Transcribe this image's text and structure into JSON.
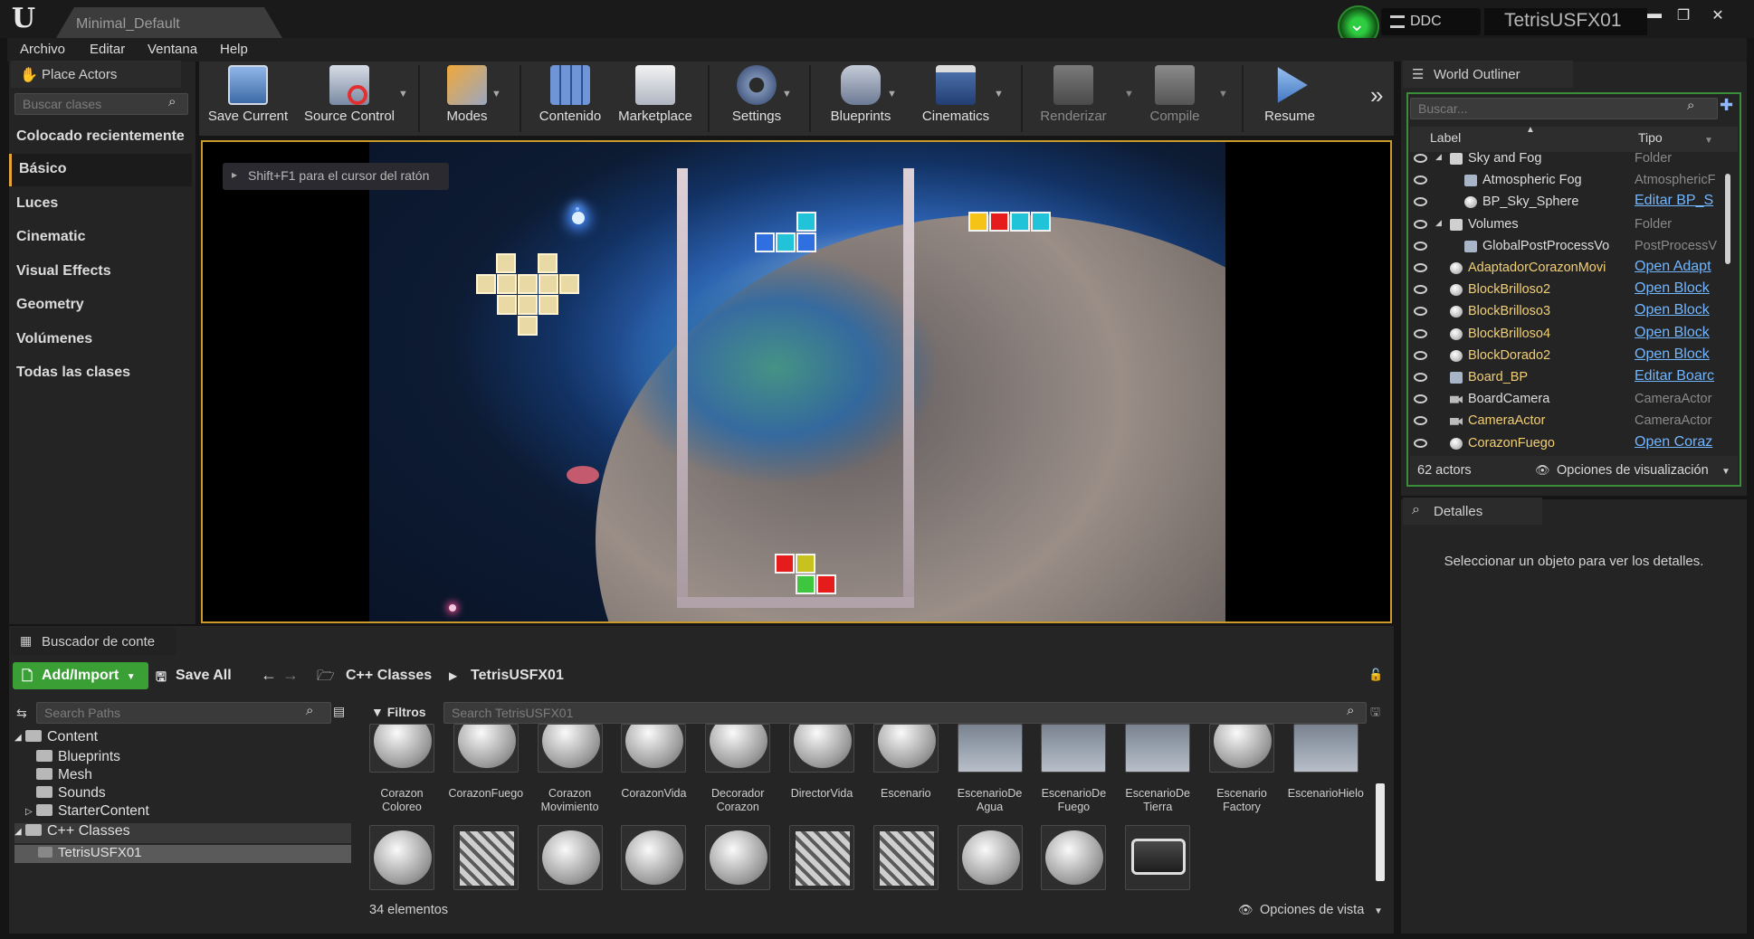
{
  "title_bar": {
    "map_tab": "Minimal_Default",
    "ddc_label": "DDC",
    "project_name": "TetrisUSFX01",
    "minimize_glyph": "▬",
    "restore_glyph": "❐",
    "close_glyph": "✕"
  },
  "menu": [
    "Archivo",
    "Editar",
    "Ventana",
    "Help"
  ],
  "place_actors": {
    "tab_label": "Place Actors",
    "search_placeholder": "Buscar clases",
    "categories": [
      "Colocado recientemente",
      "Básico",
      "Luces",
      "Cinematic",
      "Visual Effects",
      "Geometry",
      "Volúmenes",
      "Todas las clases"
    ],
    "selected": "Básico"
  },
  "toolbar": {
    "buttons": [
      {
        "label": "Save Current",
        "icon": "floppy-disk-icon"
      },
      {
        "label": "Source Control",
        "icon": "source-control-icon"
      },
      {
        "label": "Modes",
        "icon": "modes-icon"
      },
      {
        "label": "Contenido",
        "icon": "content-grid-icon"
      },
      {
        "label": "Marketplace",
        "icon": "marketplace-bag-icon"
      },
      {
        "label": "Settings",
        "icon": "gear-icon"
      },
      {
        "label": "Blueprints",
        "icon": "gamepad-icon"
      },
      {
        "label": "Cinematics",
        "icon": "clapperboard-icon"
      },
      {
        "label": "Renderizar",
        "icon": "build-icon"
      },
      {
        "label": "Compile",
        "icon": "compile-cubes-icon"
      },
      {
        "label": "Resume",
        "icon": "play-resume-icon"
      }
    ],
    "overflow_glyph": "»"
  },
  "viewport": {
    "hint": "Shift+F1 para el cursor del ratón",
    "colors": {
      "blue": "#2f6fe0",
      "cyan": "#21c3d8",
      "yellow": "#f4c316",
      "red": "#e61b1b",
      "green": "#3ec63e",
      "olive": "#c8c21e"
    }
  },
  "world_outliner": {
    "tab_label": "World Outliner",
    "search_placeholder": "Buscar...",
    "col_label": "Label",
    "col_type": "Tipo",
    "rows": [
      {
        "label": "Sky and Fog",
        "type": "Folder",
        "indent": 1,
        "kind": "folder",
        "link": false,
        "yellow": false
      },
      {
        "label": "Atmospheric Fog",
        "type": "AtmosphericF",
        "indent": 2,
        "kind": "actor",
        "link": false,
        "yellow": false
      },
      {
        "label": "BP_Sky_Sphere",
        "type": "Editar BP_S",
        "indent": 2,
        "kind": "sphere",
        "link": true,
        "yellow": false
      },
      {
        "label": "Volumes",
        "type": "Folder",
        "indent": 1,
        "kind": "folder",
        "link": false,
        "yellow": false
      },
      {
        "label": "GlobalPostProcessVo",
        "type": "PostProcessV",
        "indent": 2,
        "kind": "volume",
        "link": false,
        "yellow": false
      },
      {
        "label": "AdaptadorCorazonMovi",
        "type": "Open Adapt",
        "indent": 1,
        "kind": "sphere",
        "link": true,
        "yellow": true
      },
      {
        "label": "BlockBrilloso2",
        "type": "Open Block",
        "indent": 1,
        "kind": "sphere",
        "link": true,
        "yellow": true
      },
      {
        "label": "BlockBrilloso3",
        "type": "Open Block",
        "indent": 1,
        "kind": "sphere",
        "link": true,
        "yellow": true
      },
      {
        "label": "BlockBrilloso4",
        "type": "Open Block",
        "indent": 1,
        "kind": "sphere",
        "link": true,
        "yellow": true
      },
      {
        "label": "BlockDorado2",
        "type": "Open Block",
        "indent": 1,
        "kind": "sphere",
        "link": true,
        "yellow": true
      },
      {
        "label": "Board_BP",
        "type": "Editar Boarc",
        "indent": 1,
        "kind": "pawn",
        "link": true,
        "yellow": true
      },
      {
        "label": "BoardCamera",
        "type": "CameraActor",
        "indent": 1,
        "kind": "camera",
        "link": false,
        "yellow": false
      },
      {
        "label": "CameraActor",
        "type": "CameraActor",
        "indent": 1,
        "kind": "camera",
        "link": false,
        "yellow": true
      },
      {
        "label": "CorazonFuego",
        "type": "Open Coraz",
        "indent": 1,
        "kind": "sphere",
        "link": true,
        "yellow": true
      }
    ],
    "actor_count": "62 actors",
    "view_options": "Opciones de visualización"
  },
  "details": {
    "tab_label": "Detalles",
    "empty_message": "Seleccionar un objeto para ver los detalles."
  },
  "content_browser": {
    "tab_label": "Buscador de conte",
    "add_import": "Add/Import",
    "save_all": "Save All",
    "path": [
      "C++ Classes",
      "TetrisUSFX01"
    ],
    "search_paths_placeholder": "Search Paths",
    "filters_label": "Filtros",
    "search_assets_placeholder": "Search TetrisUSFX01",
    "tree": [
      {
        "label": "Content",
        "level": 0,
        "expanded": true
      },
      {
        "label": "Blueprints",
        "level": 1
      },
      {
        "label": "Mesh",
        "level": 1
      },
      {
        "label": "Sounds",
        "level": 1
      },
      {
        "label": "StarterContent",
        "level": 1,
        "collapsed": true
      },
      {
        "label": "C++ Classes",
        "level": 0,
        "expanded": true
      },
      {
        "label": "TetrisUSFX01",
        "level": 1,
        "selected": true
      }
    ],
    "assets_row1": [
      {
        "label": "Corazon\nColoreo",
        "icon": "sphere"
      },
      {
        "label": "CorazonFuego",
        "icon": "sphere"
      },
      {
        "label": "Corazon\nMovimiento",
        "icon": "sphere"
      },
      {
        "label": "CorazonVida",
        "icon": "sphere"
      },
      {
        "label": "Decorador\nCorazon",
        "icon": "sphere"
      },
      {
        "label": "DirectorVida",
        "icon": "sphere"
      },
      {
        "label": "Escenario",
        "icon": "sphere"
      },
      {
        "label": "EscenarioDe\nAgua",
        "icon": "scene"
      },
      {
        "label": "EscenarioDe\nFuego",
        "icon": "scene"
      },
      {
        "label": "EscenarioDe\nTierra",
        "icon": "scene"
      },
      {
        "label": "Escenario\nFactory",
        "icon": "sphere"
      },
      {
        "label": "EscenarioHielo",
        "icon": "scene"
      }
    ],
    "assets_row2": [
      "sphere",
      "tool",
      "sphere",
      "sphere",
      "sphere",
      "tool",
      "tool",
      "sphere",
      "sphere",
      "gamemode"
    ],
    "item_count": "34 elementos",
    "view_options": "Opciones de vista"
  }
}
